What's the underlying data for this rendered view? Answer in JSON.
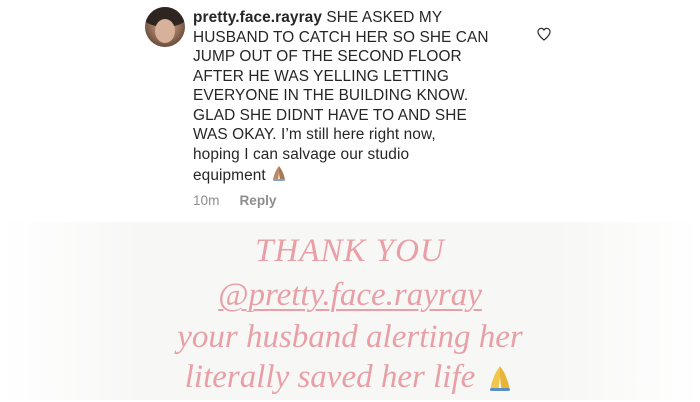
{
  "comment": {
    "username": "pretty.face.rayray",
    "text": " SHE ASKED MY\nHUSBAND TO CATCH HER SO SHE CAN\nJUMP OUT OF THE SECOND FLOOR\nAFTER HE WAS YELLING LETTING\nEVERYONE IN THE BUILDING KNOW.\nGLAD SHE DIDNT HAVE TO AND SHE\nWAS OKAY. I’m still here right now,\nhoping I can salvage our studio\nequipment",
    "emoji_icon": "folded-hands-icon",
    "time": "10m",
    "reply_label": "Reply",
    "like_icon": "heart-outline-icon"
  },
  "story": {
    "line1": "THANK YOU",
    "line2": "@pretty.face.rayray",
    "line3": "your husband alerting her",
    "line4": "literally saved her life",
    "emoji_icon": "folded-hands-icon",
    "text_color": "#e8a0a6"
  }
}
